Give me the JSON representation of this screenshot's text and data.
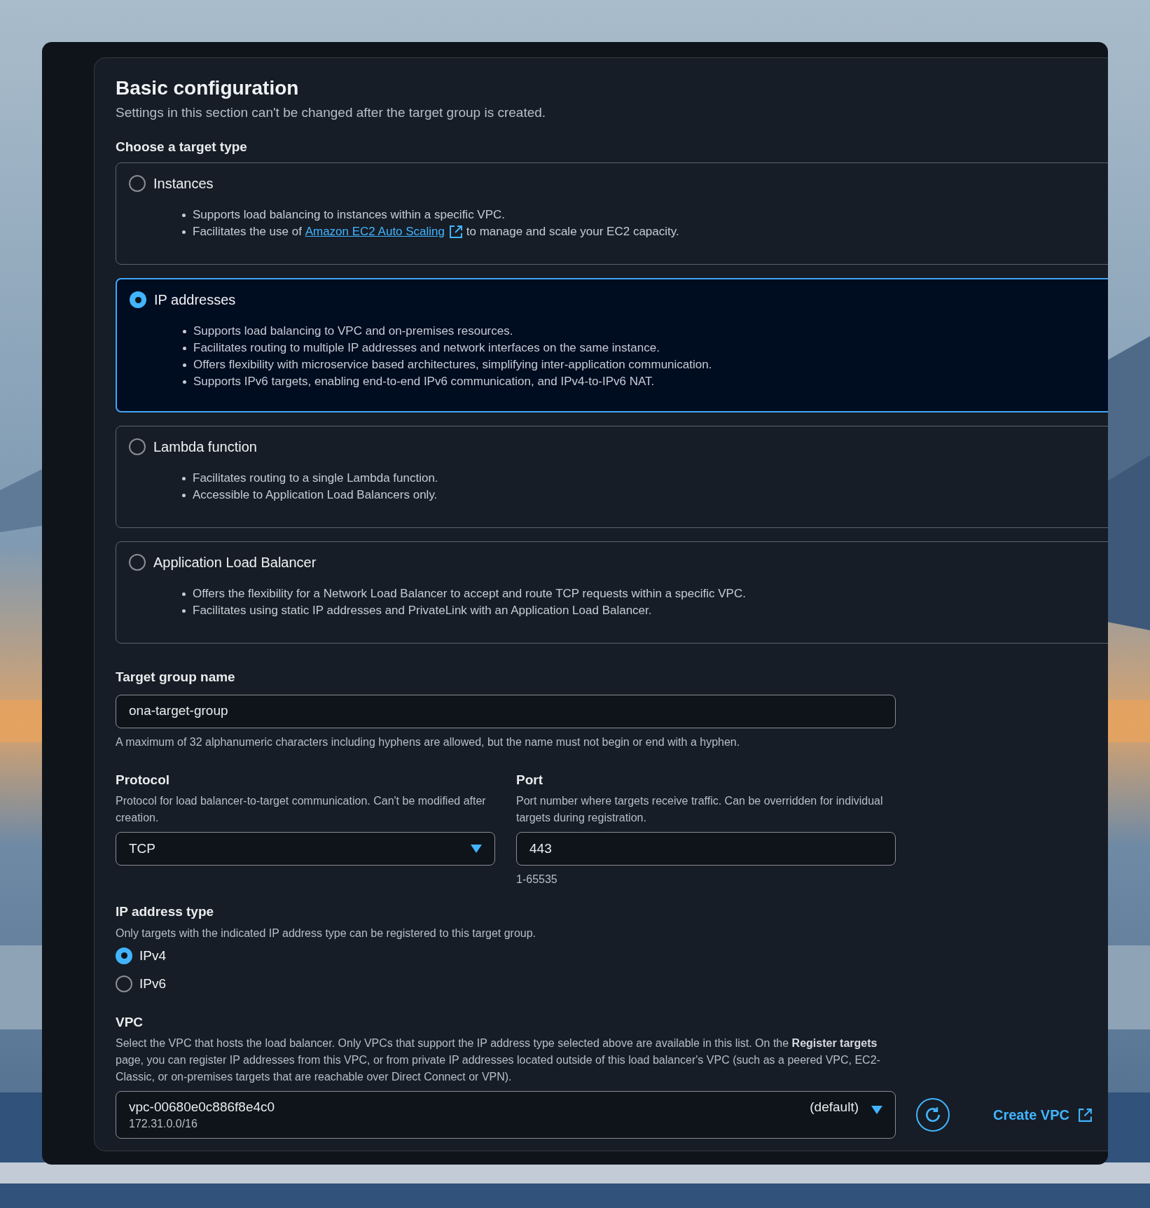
{
  "section": {
    "title": "Basic configuration",
    "description": "Settings in this section can't be changed after the target group is created."
  },
  "target_type": {
    "label": "Choose a target type",
    "options": [
      {
        "label": "Instances",
        "selected": false,
        "bullets": [
          {
            "text": "Supports load balancing to instances within a specific VPC."
          },
          {
            "text": "Facilitates the use of ",
            "link": "Amazon EC2 Auto Scaling",
            "after": " to manage and scale your EC2 capacity."
          }
        ]
      },
      {
        "label": "IP addresses",
        "selected": true,
        "bullets": [
          {
            "text": "Supports load balancing to VPC and on-premises resources."
          },
          {
            "text": "Facilitates routing to multiple IP addresses and network interfaces on the same instance."
          },
          {
            "text": "Offers flexibility with microservice based architectures, simplifying inter-application communication."
          },
          {
            "text": "Supports IPv6 targets, enabling end-to-end IPv6 communication, and IPv4-to-IPv6 NAT."
          }
        ]
      },
      {
        "label": "Lambda function",
        "selected": false,
        "bullets": [
          {
            "text": "Facilitates routing to a single Lambda function."
          },
          {
            "text": "Accessible to Application Load Balancers only."
          }
        ]
      },
      {
        "label": "Application Load Balancer",
        "selected": false,
        "bullets": [
          {
            "text": "Offers the flexibility for a Network Load Balancer to accept and route TCP requests within a specific VPC."
          },
          {
            "text": "Facilitates using static IP addresses and PrivateLink with an Application Load Balancer."
          }
        ]
      }
    ]
  },
  "target_group_name": {
    "label": "Target group name",
    "value": "ona-target-group",
    "hint": "A maximum of 32 alphanumeric characters including hyphens are allowed, but the name must not begin or end with a hyphen."
  },
  "protocol": {
    "label": "Protocol",
    "description": "Protocol for load balancer-to-target communication. Can't be modified after creation.",
    "value": "TCP"
  },
  "port": {
    "label": "Port",
    "description": "Port number where targets receive traffic. Can be overridden for individual targets during registration.",
    "value": "443",
    "hint": "1-65535"
  },
  "ip_address_type": {
    "label": "IP address type",
    "description": "Only targets with the indicated IP address type can be registered to this target group.",
    "options": [
      {
        "label": "IPv4",
        "selected": true
      },
      {
        "label": "IPv6",
        "selected": false
      }
    ]
  },
  "vpc": {
    "label": "VPC",
    "description": "Select the VPC that hosts the load balancer. Only VPCs that support the IP address type selected above are available in this list. On the **Register targets** page, you can register IP addresses from this VPC, or from private IP addresses located outside of this load balancer's VPC (such as a peered VPC, EC2-Classic, or on-premises targets that are reachable over Direct Connect or VPN).",
    "value": "vpc-00680e0c886f8e4c0",
    "tag": "(default)",
    "cidr": "172.31.0.0/16",
    "create_link": "Create VPC"
  }
}
